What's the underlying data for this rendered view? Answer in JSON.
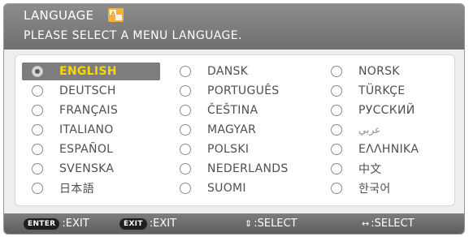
{
  "header": {
    "title": "LANGUAGE",
    "subtitle": "PLEASE SELECT A MENU LANGUAGE."
  },
  "languages": [
    [
      "ENGLISH",
      "DANSK",
      "NORSK"
    ],
    [
      "DEUTSCH",
      "PORTUGUÊS",
      "TÜRKÇE"
    ],
    [
      "FRANÇAIS",
      "ČEŠTINA",
      "РУССКИЙ"
    ],
    [
      "ITALIANO",
      "MAGYAR",
      "عربي"
    ],
    [
      "ESPAÑOL",
      "POLSKI",
      "ΕΛΛΗΝΙΚΑ"
    ],
    [
      "SVENSKA",
      "NEDERLANDS",
      "中文"
    ],
    [
      "日本語",
      "SUOMI",
      "한국어"
    ]
  ],
  "selected_language": "ENGLISH",
  "footer": {
    "enter_key": "ENTER",
    "enter_action": ":EXIT",
    "exit_key": "EXIT",
    "exit_action": ":EXIT",
    "updown_symbol": "⇕",
    "updown_action": ":SELECT",
    "leftright_symbol": "↔",
    "leftright_action": ":SELECT"
  },
  "colors": {
    "selected_text": "#ffd700",
    "header_bg": "#7a7a7a",
    "panel_bg": "#ffffff"
  }
}
